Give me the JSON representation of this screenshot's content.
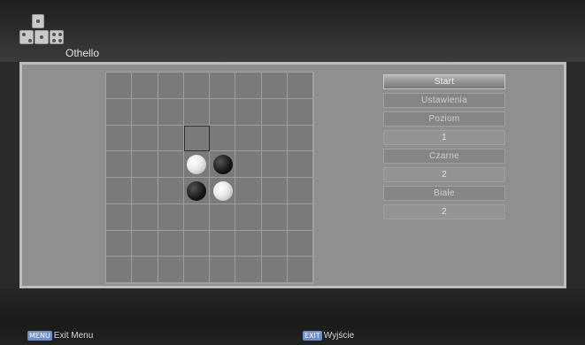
{
  "app": {
    "title": "Othello",
    "icon": "dice-icon"
  },
  "game": {
    "board_size": 8,
    "cursor": {
      "row": 2,
      "col": 3
    },
    "discs": [
      {
        "row": 3,
        "col": 3,
        "color": "white"
      },
      {
        "row": 3,
        "col": 4,
        "color": "black"
      },
      {
        "row": 4,
        "col": 3,
        "color": "black"
      },
      {
        "row": 4,
        "col": 4,
        "color": "white"
      }
    ]
  },
  "menu": {
    "start": "Start",
    "settings": "Ustawienia",
    "level_label": "Poziom",
    "level_value": "1",
    "black_label": "Czarne",
    "black_value": "2",
    "white_label": "Białe",
    "white_value": "2"
  },
  "footer": {
    "menu_key": "MENU",
    "menu_label": "Exit Menu",
    "exit_key": "EXIT",
    "exit_label": "Wyjście"
  },
  "colors": {
    "key_badge": "#6c8fc8",
    "selected_item": "#a8a8a8"
  }
}
